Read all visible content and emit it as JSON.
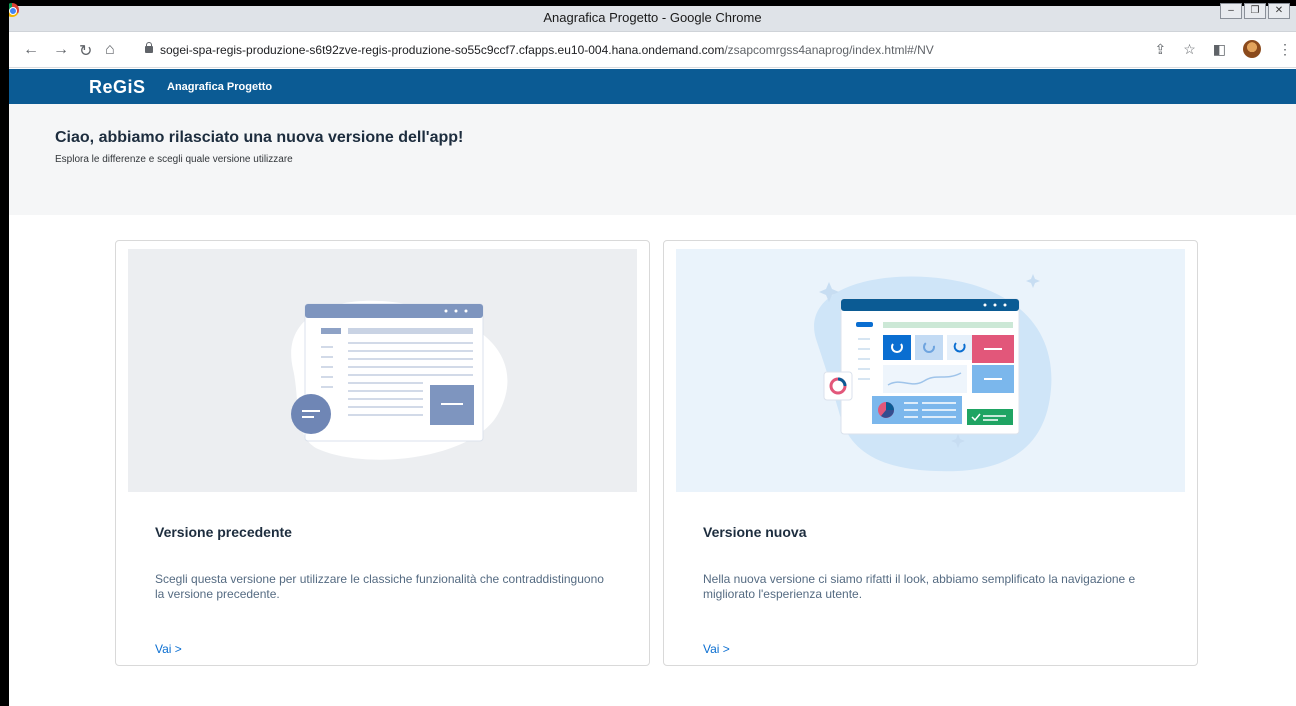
{
  "window": {
    "title": "Anagrafica Progetto - Google Chrome"
  },
  "browser": {
    "url_host": "sogei-spa-regis-produzione-s6t92zve-regis-produzione-so55c9ccf7.cfapps.eu10-004.hana.ondemand.com",
    "url_path": "/zsapcomrgss4anaprog/index.html#/NV"
  },
  "app": {
    "logo": "ReGiS",
    "title": "Anagrafica Progetto"
  },
  "hero": {
    "title": "Ciao, abbiamo rilasciato una nuova versione dell'app!",
    "subtitle": "Esplora le differenze e scegli quale versione utilizzare"
  },
  "cards": [
    {
      "title": "Versione precedente",
      "description": "Scegli questa versione per utilizzare le classiche funzionalità che contraddistinguono la versione precedente.",
      "link": "Vai >"
    },
    {
      "title": "Versione nuova",
      "description": "Nella nuova versione ci siamo rifatti il look, abbiamo semplificato la navigazione e migliorato l'esperienza utente.",
      "link": "Vai >"
    }
  ],
  "icons": {
    "back": "arrow-left-icon",
    "forward": "arrow-right-icon",
    "reload": "reload-icon",
    "home": "home-icon",
    "share": "share-icon",
    "bookmark": "star-icon",
    "sidepanel": "side-panel-icon",
    "menu": "kebab-menu-icon"
  },
  "colors": {
    "appbar": "#0b5b94",
    "link": "#0a6ed1",
    "accent_pink": "#e2577a",
    "accent_green": "#1fa463"
  }
}
